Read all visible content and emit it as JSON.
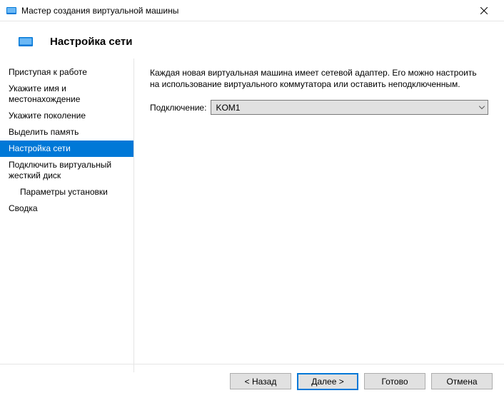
{
  "window": {
    "title": "Мастер создания виртуальной машины"
  },
  "header": {
    "title": "Настройка сети"
  },
  "sidebar": {
    "items": [
      {
        "label": "Приступая к работе",
        "selected": false,
        "indent": false
      },
      {
        "label": "Укажите имя и местонахождение",
        "selected": false,
        "indent": false
      },
      {
        "label": "Укажите поколение",
        "selected": false,
        "indent": false
      },
      {
        "label": "Выделить память",
        "selected": false,
        "indent": false
      },
      {
        "label": "Настройка сети",
        "selected": true,
        "indent": false
      },
      {
        "label": "Подключить виртуальный жесткий диск",
        "selected": false,
        "indent": false
      },
      {
        "label": "Параметры установки",
        "selected": false,
        "indent": true
      },
      {
        "label": "Сводка",
        "selected": false,
        "indent": false
      }
    ]
  },
  "main": {
    "description": "Каждая новая виртуальная машина имеет сетевой адаптер. Его можно настроить на использование виртуального коммутатора или оставить неподключенным.",
    "connection_label": "Подключение:",
    "connection_value": "KOM1"
  },
  "footer": {
    "back": "< Назад",
    "next": "Далее >",
    "finish": "Готово",
    "cancel": "Отмена"
  }
}
